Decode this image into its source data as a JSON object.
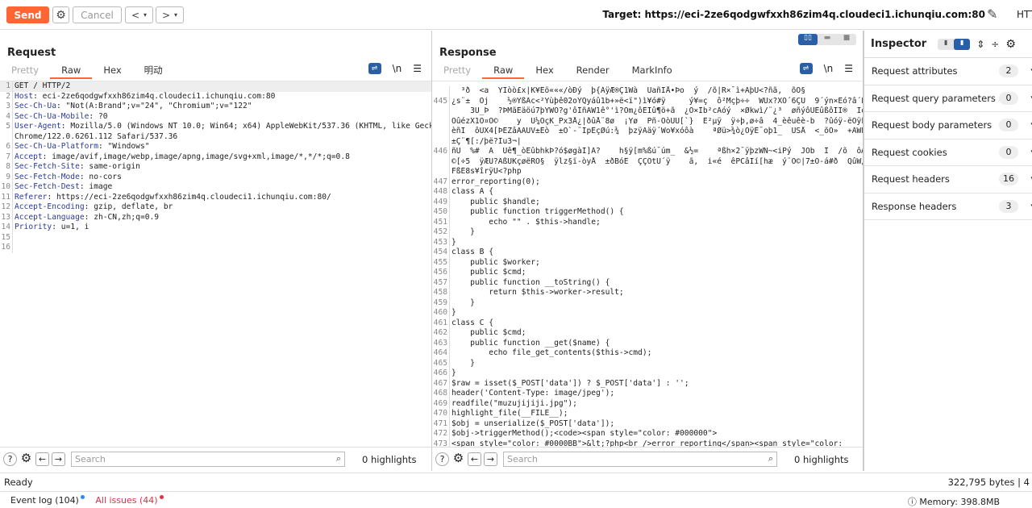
{
  "toolbar": {
    "send": "Send",
    "cancel": "Cancel",
    "prev": "<",
    "next": ">",
    "target": "Target: https://eci-2ze6qodgwfxxh86zim4q.cloudeci1.ichunqiu.com:80",
    "http_label": "HTT"
  },
  "colors": {
    "accent": "#ff6633",
    "header_name": "#2a3a9a",
    "toggle_active": "#2a5fa5"
  },
  "request": {
    "title": "Request",
    "tabs": [
      "Pretty",
      "Raw",
      "Hex",
      "明动"
    ],
    "active_tab": "Raw",
    "lines": [
      {
        "n": "1",
        "name": "",
        "val": "GET / HTTP/2"
      },
      {
        "n": "2",
        "name": "Host",
        "val": ": eci-2ze6qodgwfxxh86zim4q.cloudeci1.ichunqiu.com:80"
      },
      {
        "n": "3",
        "name": "Sec-Ch-Ua",
        "val": ": \"Not(A:Brand\";v=\"24\", \"Chromium\";v=\"122\""
      },
      {
        "n": "4",
        "name": "Sec-Ch-Ua-Mobile",
        "val": ": ?0"
      },
      {
        "n": "5",
        "name": "User-Agent",
        "val": ": Mozilla/5.0 (Windows NT 10.0; Win64; x64) AppleWebKit/537.36 (KHTML, like Gecko)"
      },
      {
        "n": "",
        "name": "",
        "val": "Chrome/122.0.6261.112 Safari/537.36"
      },
      {
        "n": "6",
        "name": "Sec-Ch-Ua-Platform",
        "val": ": \"Windows\""
      },
      {
        "n": "7",
        "name": "Accept",
        "val": ": image/avif,image/webp,image/apng,image/svg+xml,image/*,*/*;q=0.8"
      },
      {
        "n": "8",
        "name": "Sec-Fetch-Site",
        "val": ": same-origin"
      },
      {
        "n": "9",
        "name": "Sec-Fetch-Mode",
        "val": ": no-cors"
      },
      {
        "n": "10",
        "name": "Sec-Fetch-Dest",
        "val": ": image"
      },
      {
        "n": "11",
        "name": "Referer",
        "val": ": https://eci-2ze6qodgwfxxh86zim4q.cloudeci1.ichunqiu.com:80/"
      },
      {
        "n": "12",
        "name": "Accept-Encoding",
        "val": ": gzip, deflate, br"
      },
      {
        "n": "13",
        "name": "Accept-Language",
        "val": ": zh-CN,zh;q=0.9"
      },
      {
        "n": "14",
        "name": "Priority",
        "val": ": u=1, i"
      },
      {
        "n": "15",
        "name": "",
        "val": ""
      },
      {
        "n": "16",
        "name": "",
        "val": ""
      }
    ],
    "search_placeholder": "Search",
    "highlights": "0 highlights"
  },
  "response": {
    "title": "Response",
    "tabs": [
      "Pretty",
      "Raw",
      "Hex",
      "Render",
      "MarkInfo"
    ],
    "active_tab": "Raw",
    "lines": [
      {
        "n": "",
        "val": "  ³ð  <a  ŸÏòò£x|K¥Êö«««/òÐý  þ{ÁÿÆ®Ç1Wà  ŪañÏÅ•Þo  ý  /õ|R×¯ì+ÃþÛ<?ñã,  õÕ§"
      },
      {
        "n": "445",
        "val": "¿s¨±  Õj    ½®YßÂc<²Yùþê02oŸQyáû1b+»ë<ï\")ì¥ó#ÿ     ý¥=ç  ô²Mçþ÷÷  WÜx?XÒ´6ÇU  9´ýn×Êó?â´Pyÿêò®"
      },
      {
        "n": "",
        "val": "    3Ù_Þ  ?ÞMãÊäöú7þYWÕ?g'ôÎñÃW1ê°'ì?Òm¿ôÊÏû¶ö+ã  ¿Õ×Ìb²cÄóý  ×Økwì/¨¿³  øñýôUÊûßôÏÏ®  Ïóû6_\"y|ë"
      },
      {
        "n": "",
        "val": "ÒûézX1Ò¤Ò©    y  Ü¼ÔçK_Px3Å¿|ðûÅ¨8ø  ¡Ÿø  Pñ-ÔòÜÛ[`}  Ê²µÿ  ÿ÷þ,ø÷â  4_èêuêè-b  ?ûóÿ-ëÖÿk  ¬ÖÅ  ¯"
      },
      {
        "n": "",
        "val": "èñI  ôÛX4[ÞÊZâÃÄÛV±Êò  ±Ô`-¨ÌpÊçØú:¾  þzÿÃäÿ´Wo¥xóôà    ªØü>¾ò¿ÕÿÊ¯oþ1_  ÛSÅ  <_õÒ»  +ÁWÞTPA/ú  ò"
      },
      {
        "n": "",
        "val": "±Ç¨¶[:/þë?Iu3¬|"
      },
      {
        "n": "446",
        "val": "ñU  %#  Á  Ûê¶_òÊûbhkÞ?ó$øgàÌ]Á?    h§ÿ[m%ßú¯úm_  &½=    ªßh×2¯ÿþzWÑ~<iPý  JÖb  Î  /õ  ôÆ½Ç#ëDîÊ¾"
      },
      {
        "n": "",
        "val": "©[÷5  ÿÆÛ?ÃßÛKçøëRÒ§  ÿlz§ï-òyÅ  ±ðBóÊ  ÇÇÔtÛ´ÿ    ã,  i«é  êPCâÏí[hæ  ý¨O©|7±Õ-á#ð  QûW¿òÌ  Y"
      },
      {
        "n": "",
        "val": "FßÊ8s¥îrÿÜ<?php"
      },
      {
        "n": "447",
        "val": "error_reporting(0);"
      },
      {
        "n": "448",
        "val": "class A {"
      },
      {
        "n": "449",
        "val": "    public $handle;"
      },
      {
        "n": "450",
        "val": "    public function triggerMethod() {"
      },
      {
        "n": "451",
        "val": "        echo \"\" . $this->handle;"
      },
      {
        "n": "452",
        "val": "    }"
      },
      {
        "n": "453",
        "val": "}"
      },
      {
        "n": "454",
        "val": "class B {"
      },
      {
        "n": "455",
        "val": "    public $worker;"
      },
      {
        "n": "456",
        "val": "    public $cmd;"
      },
      {
        "n": "457",
        "val": "    public function __toString() {"
      },
      {
        "n": "458",
        "val": "        return $this->worker->result;"
      },
      {
        "n": "459",
        "val": "    }"
      },
      {
        "n": "460",
        "val": "}"
      },
      {
        "n": "461",
        "val": "class C {"
      },
      {
        "n": "462",
        "val": "    public $cmd;"
      },
      {
        "n": "463",
        "val": "    public function __get($name) {"
      },
      {
        "n": "464",
        "val": "        echo file_get_contents($this->cmd);"
      },
      {
        "n": "465",
        "val": "    }"
      },
      {
        "n": "466",
        "val": "}"
      },
      {
        "n": "467",
        "val": "$raw = isset($_POST['data']) ? $_POST['data'] : '';"
      },
      {
        "n": "468",
        "val": "header('Content-Type: image/jpeg');"
      },
      {
        "n": "469",
        "val": "readfile(\"muzujijiji.jpg\");"
      },
      {
        "n": "470",
        "val": "highlight_file(__FILE__);"
      },
      {
        "n": "471",
        "val": "$obj = unserialize($_POST['data']);"
      },
      {
        "n": "472",
        "val": "$obj->triggerMethod();<code><span style=\"color: #000000\">"
      },
      {
        "n": "473",
        "val": "<span style=\"color: #0000BB\">&lt;?php<br />error_reporting</span><span style=\"color:"
      }
    ],
    "search_placeholder": "Search",
    "highlights": "0 highlights"
  },
  "inspector": {
    "title": "Inspector",
    "sections": [
      {
        "label": "Request attributes",
        "count": "2"
      },
      {
        "label": "Request query parameters",
        "count": "0"
      },
      {
        "label": "Request body parameters",
        "count": "0"
      },
      {
        "label": "Request cookies",
        "count": "0"
      },
      {
        "label": "Request headers",
        "count": "16"
      },
      {
        "label": "Response headers",
        "count": "3"
      }
    ]
  },
  "status": {
    "left": "Ready",
    "right": "322,795 bytes | 4"
  },
  "footer": {
    "event_log": "Event log (104)",
    "issues": "All issues (44)",
    "memory": "Memory: 398.8MB"
  }
}
